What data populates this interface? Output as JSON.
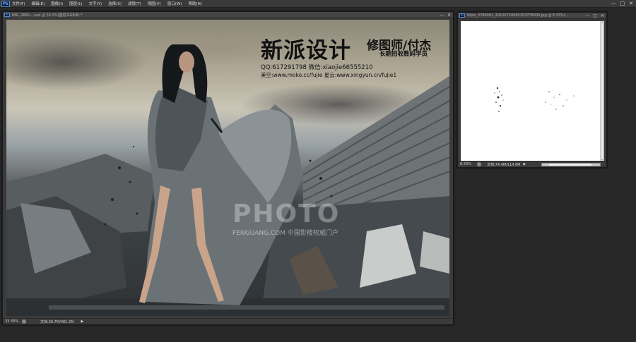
{
  "app": {
    "logo": "Ps",
    "menu": [
      "文件(F)",
      "编辑(E)",
      "图像(I)",
      "图层(L)",
      "文字(Y)",
      "选择(S)",
      "滤镜(T)",
      "视图(V)",
      "窗口(W)",
      "帮助(H)"
    ],
    "window_controls": [
      "—",
      "□",
      "✕"
    ]
  },
  "main_doc": {
    "title": "IMG_2666-...psd @ 33.3%(图层,RGB/8) *",
    "buttons": [
      "—",
      "✕"
    ],
    "status": {
      "zoom": "33.33%",
      "doc_size": "文档:39.7M/481.2M",
      "arrow": "▶"
    },
    "overlay": {
      "brand": "新派设计",
      "role": "修图师/付杰",
      "recruit": "长期招收数码学员",
      "contact": "QQ:617291798  微信:xiaojie66555210",
      "links": "美空:www.moko.cc/fujie  星云:www.xingyun.cn/fujie1",
      "watermark": "PHOTO",
      "watermark_sub": "FENGUANG.COM 中国影楼权威门户"
    }
  },
  "side_doc": {
    "title": "Nipic_2786001_20120710083253778000.jpg @ 8.33%(...",
    "buttons": [
      "—",
      "□",
      "✕"
    ],
    "status": {
      "zoom": "8.33%",
      "doc_size": "文档:74.4M/114.6M",
      "arrow": "▶"
    }
  },
  "colors": {
    "workspace": "#282828",
    "menubar": "#3a3a3a",
    "accent": "#4c8bd6"
  }
}
